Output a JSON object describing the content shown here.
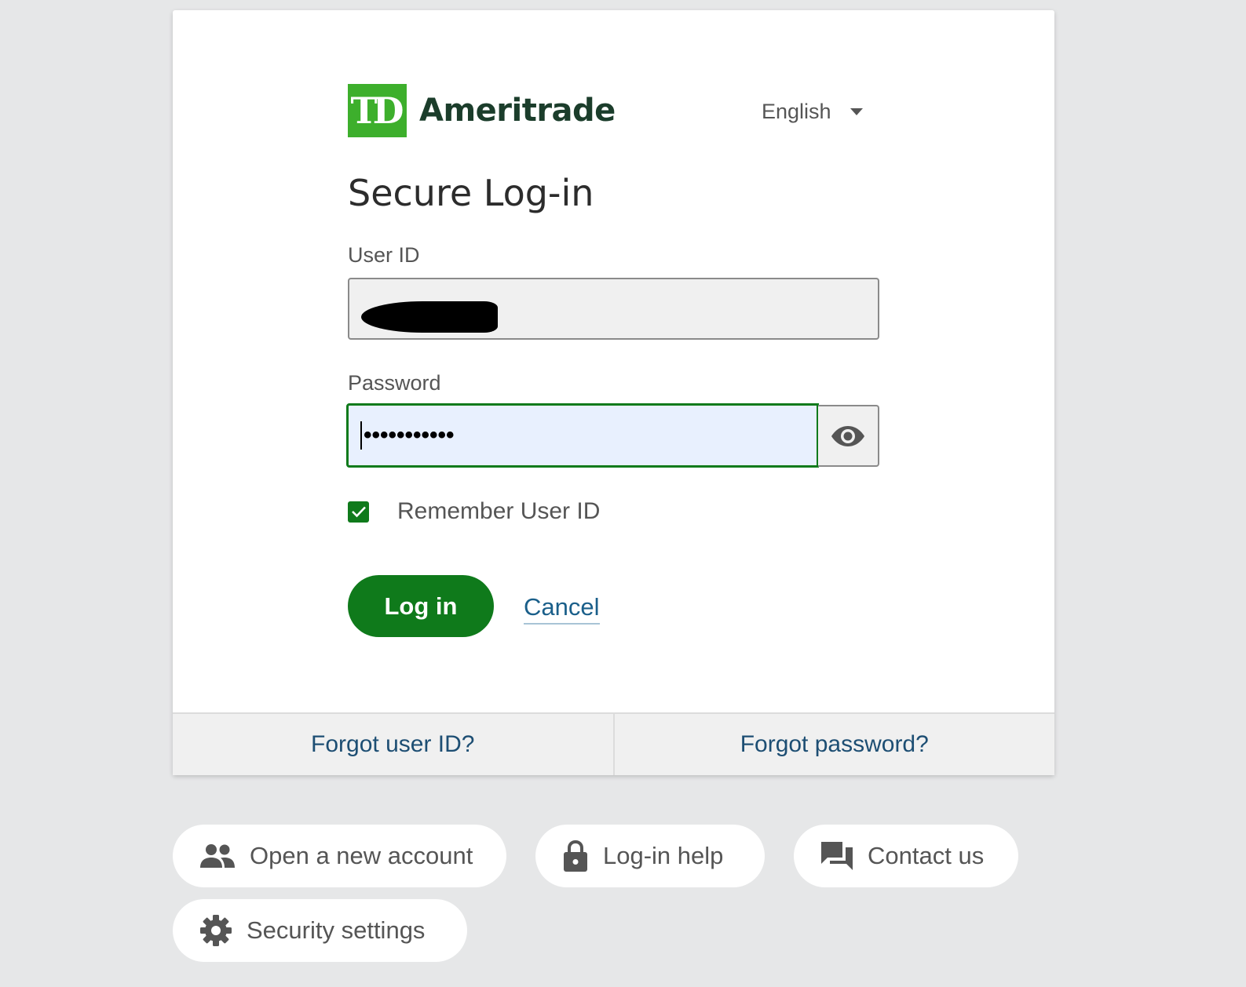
{
  "brand": {
    "mark": "TD",
    "name": "Ameritrade",
    "mark_color": "#3daf2c"
  },
  "language": {
    "selected": "English"
  },
  "title": "Secure Log-in",
  "user_id": {
    "label": "User ID",
    "value": ""
  },
  "password": {
    "label": "Password",
    "masked_value": "•••••••••••"
  },
  "remember": {
    "label": "Remember User ID",
    "checked": true
  },
  "actions": {
    "login": "Log in",
    "cancel": "Cancel"
  },
  "footer_links": {
    "forgot_user_id": "Forgot user ID?",
    "forgot_password": "Forgot password?"
  },
  "quick_links": {
    "open_account": "Open a new account",
    "login_help": "Log-in help",
    "contact_us": "Contact us",
    "security_settings": "Security settings"
  },
  "colors": {
    "primary_green": "#0f7a1b",
    "link_blue": "#1d4e73",
    "background": "#e6e7e8"
  }
}
